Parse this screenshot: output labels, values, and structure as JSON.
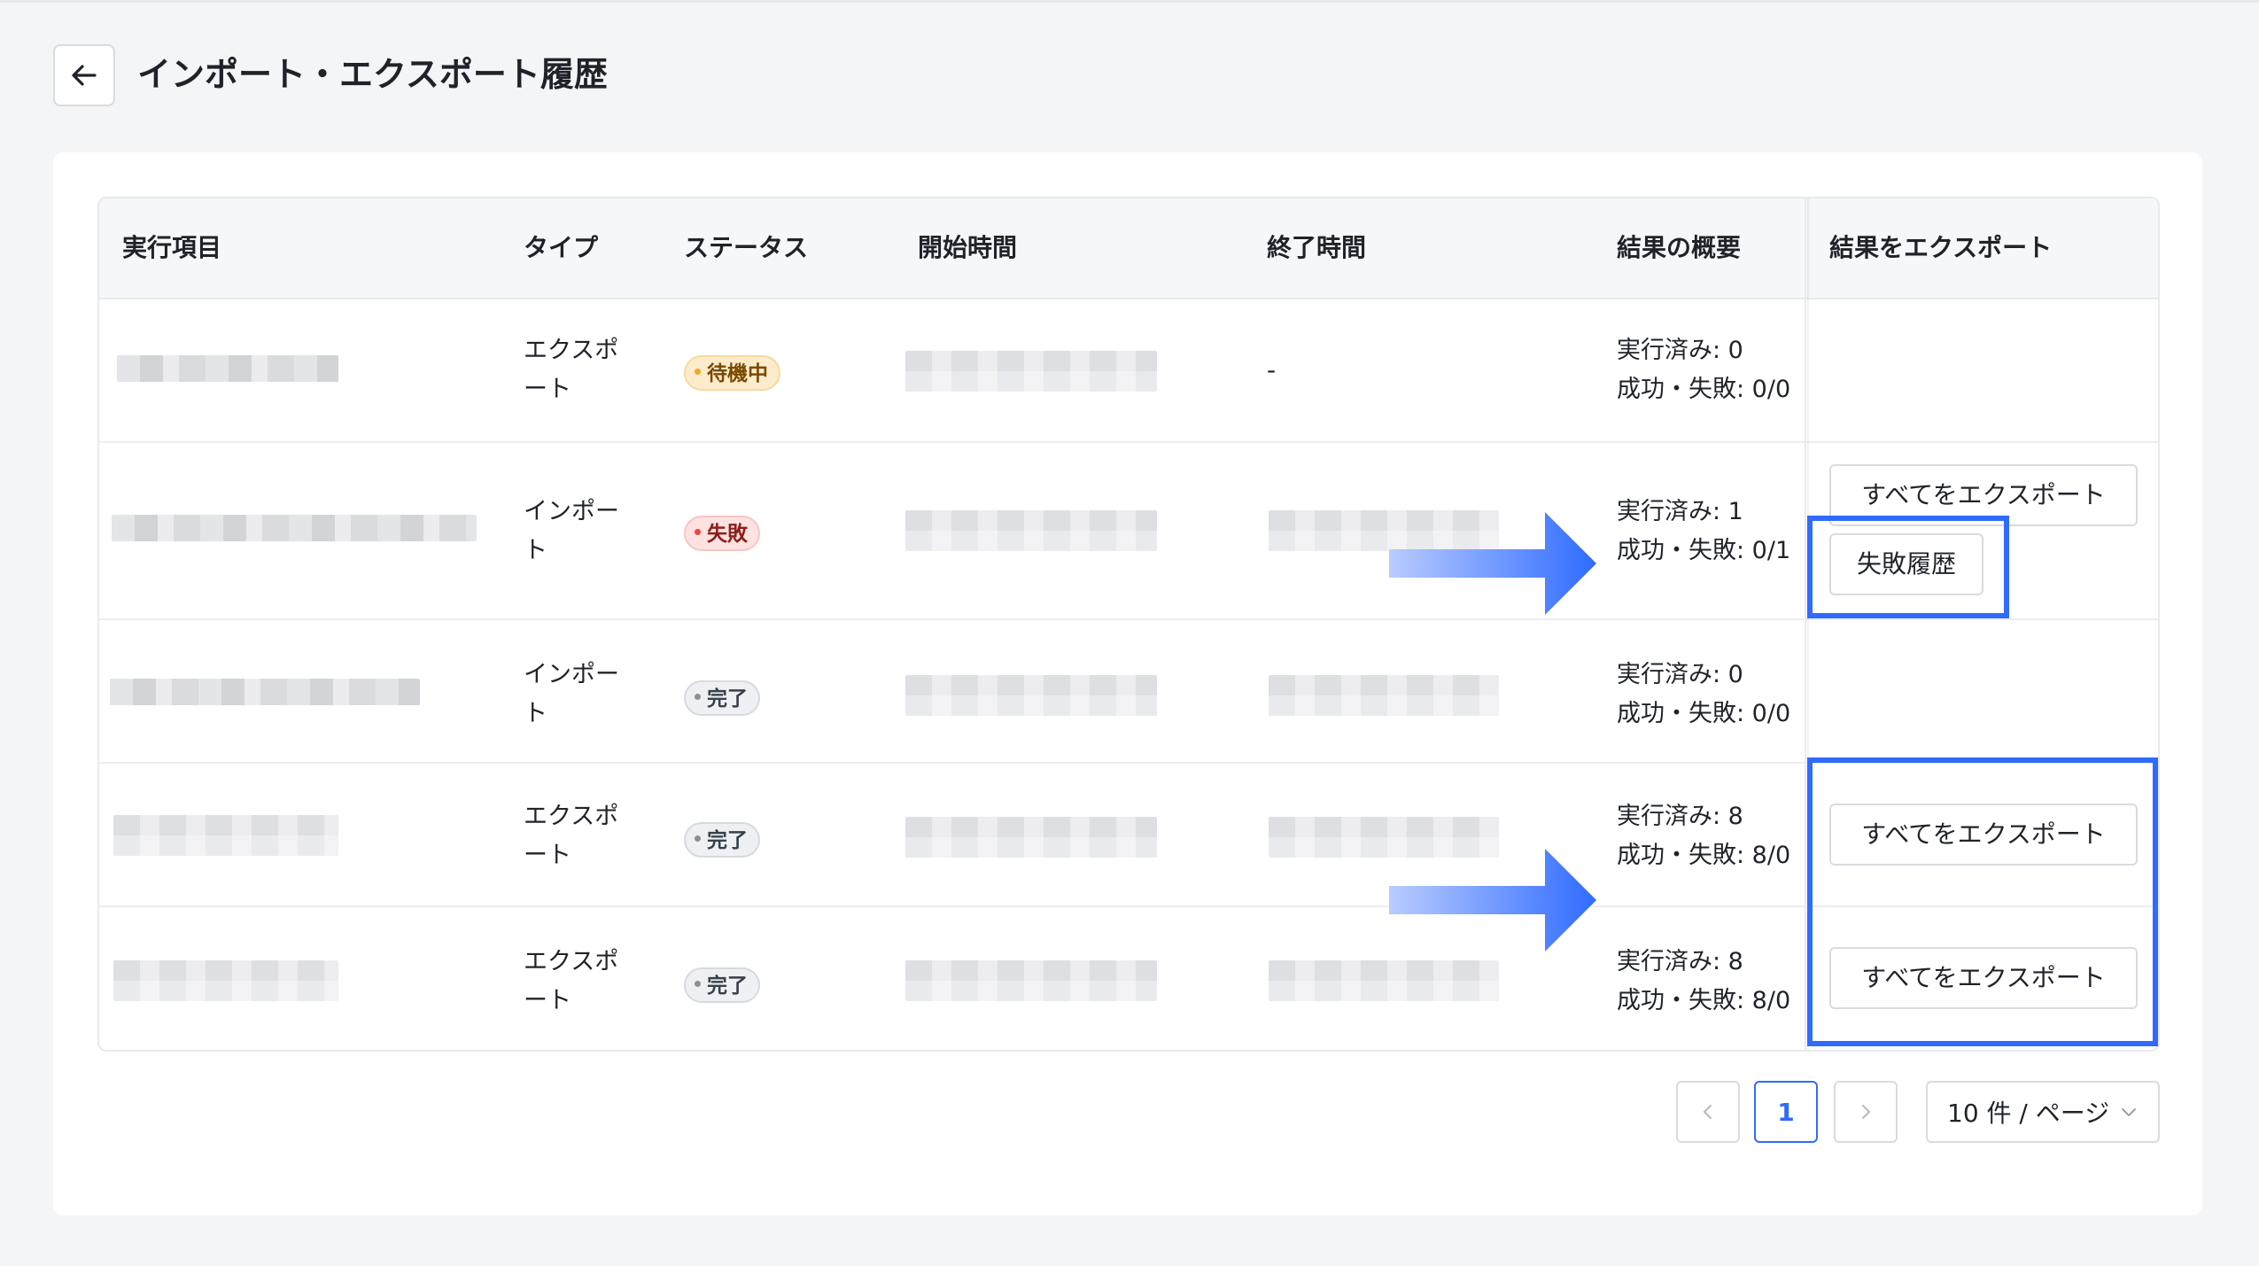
{
  "header": {
    "title": "インポート・エクスポート履歴"
  },
  "table": {
    "columns": [
      "実行項目",
      "タイプ",
      "ステータス",
      "開始時間",
      "終了時間",
      "結果の概要",
      "結果をエクスポート"
    ],
    "rows": [
      {
        "type": "エクスポート",
        "status": "待機中",
        "status_kind": "waiting",
        "end_time": "-",
        "executed": "実行済み: 0",
        "success_fail": "成功・失敗: 0/0"
      },
      {
        "type": "インポート",
        "status": "失敗",
        "status_kind": "failed",
        "executed": "実行済み: 1",
        "success_fail": "成功・失敗: 0/1",
        "actions": [
          "すべてをエクスポート",
          "失敗履歴"
        ]
      },
      {
        "type": "インポート",
        "status": "完了",
        "status_kind": "done",
        "executed": "実行済み: 0",
        "success_fail": "成功・失敗: 0/0"
      },
      {
        "type": "エクスポート",
        "status": "完了",
        "status_kind": "done",
        "executed": "実行済み: 8",
        "success_fail": "成功・失敗: 8/0",
        "actions": [
          "すべてをエクスポート"
        ]
      },
      {
        "type": "エクスポート",
        "status": "完了",
        "status_kind": "done",
        "executed": "実行済み: 8",
        "success_fail": "成功・失敗: 8/0",
        "actions": [
          "すべてをエクスポート"
        ]
      }
    ]
  },
  "pagination": {
    "current_page": "1",
    "page_size": "10 件 / ページ"
  },
  "colors": {
    "accent": "#2f6bff",
    "waiting": "#f5a623",
    "failed": "#f0443c",
    "done": "#8a9099"
  }
}
